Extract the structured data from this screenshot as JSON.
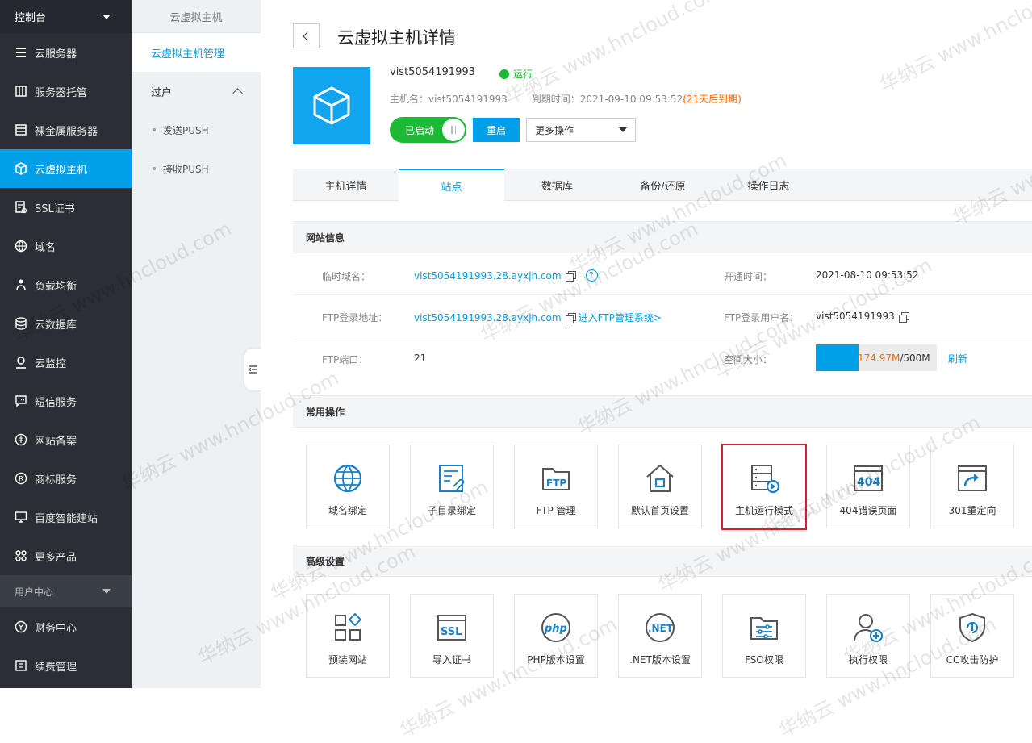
{
  "sidebar": {
    "console": "控制台",
    "items": [
      {
        "label": "云服务器",
        "icon": "server-rack-icon"
      },
      {
        "label": "服务器托管",
        "icon": "hosting-icon"
      },
      {
        "label": "裸金属服务器",
        "icon": "bare-metal-icon"
      },
      {
        "label": "云虚拟主机",
        "icon": "cube-icon",
        "active": true
      },
      {
        "label": "SSL证书",
        "icon": "certificate-icon"
      },
      {
        "label": "域名",
        "icon": "globe-icon"
      },
      {
        "label": "负载均衡",
        "icon": "load-balance-icon"
      },
      {
        "label": "云数据库",
        "icon": "database-icon"
      },
      {
        "label": "云监控",
        "icon": "monitor-icon"
      },
      {
        "label": "短信服务",
        "icon": "sms-icon"
      },
      {
        "label": "网站备案",
        "icon": "record-icon"
      },
      {
        "label": "商标服务",
        "icon": "trademark-icon"
      },
      {
        "label": "百度智能建站",
        "icon": "site-builder-icon"
      },
      {
        "label": "更多产品",
        "icon": "grid-icon"
      }
    ],
    "user_center": "用户中心",
    "user_items": [
      {
        "label": "财务中心",
        "icon": "finance-icon"
      },
      {
        "label": "续费管理",
        "icon": "renew-icon"
      }
    ]
  },
  "subnav": {
    "title": "云虚拟主机",
    "manage": "云虚拟主机管理",
    "group": "过户",
    "subs": [
      "发送PUSH",
      "接收PUSH"
    ]
  },
  "page": {
    "title": "云虚拟主机详情",
    "hostname": "vist5054191993",
    "status": "运行",
    "host_label": "主机名：vist5054191993",
    "expire_label": "到期时间：2021-09-10 09:53:52",
    "expire_warn": "(21天后到期)",
    "toggle": "已启动",
    "restart": "重启",
    "more_ops": "更多操作"
  },
  "tabs": [
    "主机详情",
    "站点",
    "数据库",
    "备份/还原",
    "操作日志"
  ],
  "site_info": {
    "section": "网站信息",
    "temp_domain_label": "临时域名：",
    "temp_domain": "vist5054191993.28.ayxjh.com",
    "open_time_label": "开通时间：",
    "open_time": "2021-08-10 09:53:52",
    "ftp_addr_label": "FTP登录地址：",
    "ftp_addr": "vist5054191993.28.ayxjh.com",
    "ftp_manage": "进入FTP管理系统>",
    "ftp_user_label": "FTP登录用户名：",
    "ftp_user": "vist5054191993",
    "ftp_port_label": "FTP端口：",
    "ftp_port": "21",
    "space_label": "空间大小：",
    "space_used": "174.97M",
    "space_total": "/500M",
    "space_fraction": 0.35,
    "refresh": "刷新"
  },
  "common_ops": {
    "section": "常用操作",
    "items": [
      "域名绑定",
      "子目录绑定",
      "FTP 管理",
      "默认首页设置",
      "主机运行模式",
      "404错误页面",
      "301重定向"
    ]
  },
  "advanced": {
    "section": "高级设置",
    "items": [
      "预装网站",
      "导入证书",
      "PHP版本设置",
      ".NET版本设置",
      "FSO权限",
      "执行权限",
      "CC攻击防护"
    ]
  },
  "colors": {
    "primary": "#009fe8",
    "sidebar": "#2b2e35",
    "success": "#1bb934",
    "warn": "#ff6a00",
    "highlight": "#e02020"
  },
  "watermark": "华纳云 www.hncloud.com"
}
